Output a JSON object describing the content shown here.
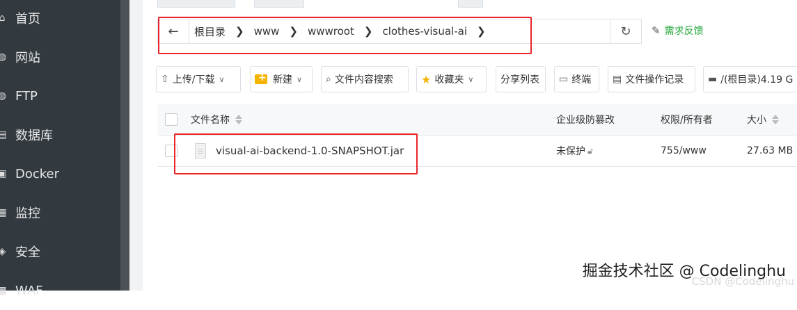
{
  "sidebar": {
    "items": [
      {
        "label": "首页",
        "icon": "home-icon"
      },
      {
        "label": "网站",
        "icon": "globe-icon"
      },
      {
        "label": "FTP",
        "icon": "globe-icon"
      },
      {
        "label": "数据库",
        "icon": "database-icon"
      },
      {
        "label": "Docker",
        "icon": "docker-icon"
      },
      {
        "label": "监控",
        "icon": "monitor-icon"
      },
      {
        "label": "安全",
        "icon": "shield-icon"
      },
      {
        "label": "WAF",
        "icon": "firewall-icon"
      }
    ]
  },
  "pathbar": {
    "crumbs": [
      "根目录",
      "www",
      "wwwroot",
      "clothes-visual-ai"
    ]
  },
  "feedback_label": "需求反馈",
  "toolbar": {
    "upload_download": "上传/下载",
    "new": "新建",
    "content_search": "文件内容搜索",
    "favorites": "收藏夹",
    "share_list": "分享列表",
    "terminal": "终端",
    "operation_log": "文件操作记录",
    "disk": "/(根目录)4.19 G"
  },
  "table": {
    "headers": {
      "name": "文件名称",
      "tamper": "企业级防篡改",
      "perm_owner": "权限/所有者",
      "size": "大小"
    },
    "rows": [
      {
        "name": "visual-ai-backend-1.0-SNAPSHOT.jar",
        "tamper": "未保护",
        "perm_owner": "755/www",
        "size": "27.63 MB"
      }
    ]
  },
  "watermark": {
    "main": "掘金技术社区 @ Codelinghu",
    "faint": "CSDN @Codelinghu"
  },
  "colors": {
    "sidebar_bg": "#32393f",
    "accent_green": "#20a53a",
    "highlight_red": "#e8252b"
  }
}
